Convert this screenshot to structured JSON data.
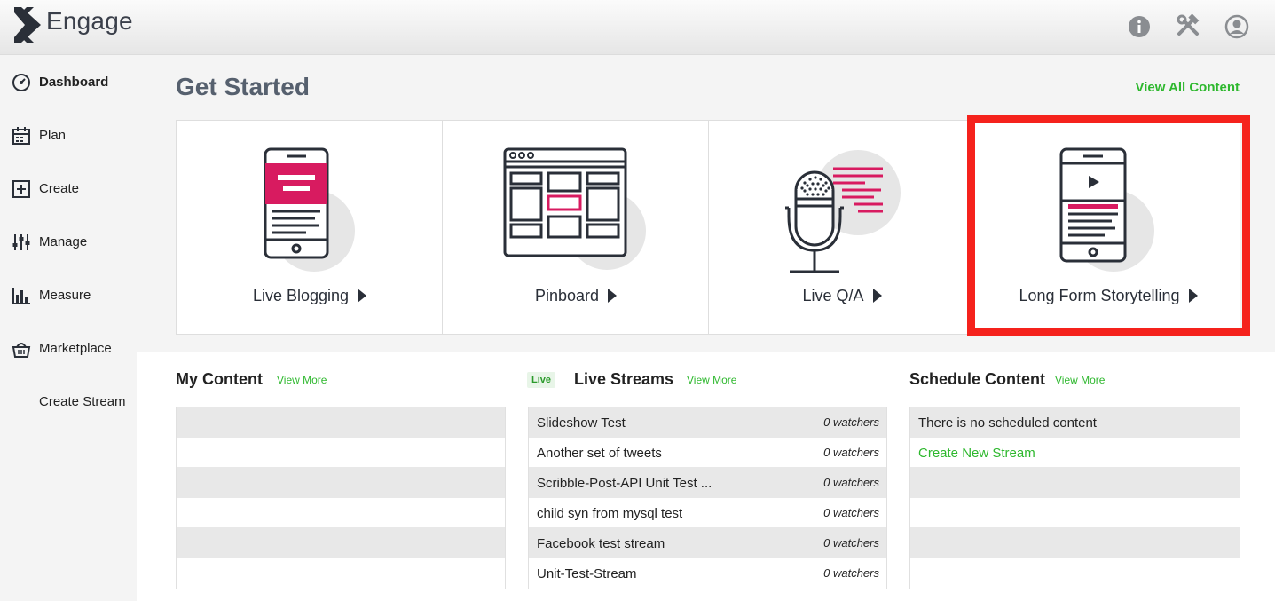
{
  "app": {
    "name": "Engage"
  },
  "top_icons": [
    "info-icon",
    "tools-icon",
    "account-icon"
  ],
  "sidebar": {
    "items": [
      {
        "label": "Dashboard",
        "icon": "dashboard-icon",
        "active": true
      },
      {
        "label": "Plan",
        "icon": "calendar-icon"
      },
      {
        "label": "Create",
        "icon": "plus-square-icon"
      },
      {
        "label": "Manage",
        "icon": "sliders-icon"
      },
      {
        "label": "Measure",
        "icon": "bar-chart-icon"
      },
      {
        "label": "Marketplace",
        "icon": "basket-icon"
      },
      {
        "label": "Create Stream",
        "icon": ""
      }
    ]
  },
  "main": {
    "title": "Get Started",
    "view_all": "View All Content",
    "cards": [
      {
        "label": "Live Blogging",
        "icon": "phone-blog-illustration"
      },
      {
        "label": "Pinboard",
        "icon": "browser-grid-illustration"
      },
      {
        "label": "Live Q/A",
        "icon": "microphone-illustration"
      },
      {
        "label": "Long Form Storytelling",
        "icon": "phone-video-illustration",
        "highlighted": true
      }
    ]
  },
  "panels": {
    "my_content": {
      "title": "My Content",
      "view_more": "View More"
    },
    "live_streams": {
      "badge": "Live",
      "title": "Live Streams",
      "view_more": "View More",
      "rows": [
        {
          "title": "Slideshow Test",
          "meta": "0 watchers"
        },
        {
          "title": "Another set of tweets",
          "meta": "0 watchers"
        },
        {
          "title": "Scribble-Post-API Unit Test ...",
          "meta": "0 watchers"
        },
        {
          "title": "child syn from mysql test",
          "meta": "0 watchers"
        },
        {
          "title": "Facebook test stream",
          "meta": "0 watchers"
        },
        {
          "title": "Unit-Test-Stream",
          "meta": "0 watchers"
        }
      ]
    },
    "schedule": {
      "title": "Schedule Content",
      "view_more": "View More",
      "empty_text": "There is no scheduled content",
      "create_link": "Create New Stream"
    }
  },
  "colors": {
    "accent_green": "#2eb82e",
    "brand_pink": "#d81b60",
    "highlight_red": "#f5221c",
    "dark": "#2a2f38"
  }
}
